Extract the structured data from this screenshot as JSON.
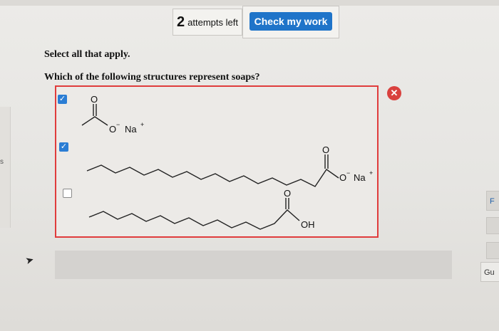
{
  "toolbar": {
    "attempts_count": "2",
    "attempts_text": "attempts left",
    "check_label": "Check my work"
  },
  "question": {
    "instruction": "Select all that apply.",
    "prompt": "Which of the following structures represent soaps?",
    "result_icon": "x-icon",
    "result_color": "#d9413e",
    "options": [
      {
        "checked": true,
        "atoms": {
          "o_top": "O",
          "o_minus": "O",
          "charge_neg": "−",
          "counter_ion": "Na",
          "charge_pos": "+"
        }
      },
      {
        "checked": true,
        "atoms": {
          "o_top": "O",
          "o_minus": "O",
          "charge_neg": "−",
          "counter_ion": "Na",
          "charge_pos": "+"
        }
      },
      {
        "checked": false,
        "atoms": {
          "o_top": "O",
          "oh": "OH"
        }
      }
    ]
  },
  "check_glyph": "✓",
  "side": {
    "left_glyph": "s",
    "right_tab_f": "F",
    "right_tab_gu": "Gu"
  },
  "colors": {
    "accent": "#1f74c9",
    "error_border": "#e03c3c",
    "checkbox": "#2b7dd4"
  }
}
